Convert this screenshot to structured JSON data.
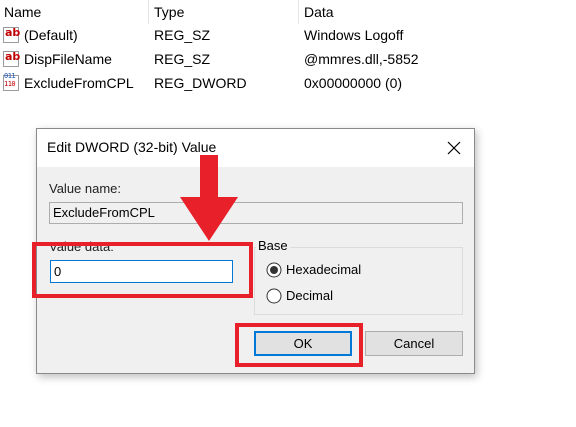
{
  "registry": {
    "headers": {
      "name": "Name",
      "type": "Type",
      "data": "Data"
    },
    "rows": [
      {
        "icon": "string-value-icon",
        "name": "(Default)",
        "type": "REG_SZ",
        "data": "Windows Logoff"
      },
      {
        "icon": "string-value-icon",
        "name": "DispFileName",
        "type": "REG_SZ",
        "data": "@mmres.dll,-5852"
      },
      {
        "icon": "dword-value-icon",
        "name": "ExcludeFromCPL",
        "type": "REG_DWORD",
        "data": "0x00000000 (0)"
      }
    ],
    "icon_glyphs": {
      "string": "ab",
      "binary_top": "011",
      "binary_bottom": "110"
    }
  },
  "dialog": {
    "title": "Edit DWORD (32-bit) Value",
    "value_name_label": "Value name:",
    "value_name": "ExcludeFromCPL",
    "value_data_label": "Value data:",
    "value_data": "0",
    "base_label": "Base",
    "base_options": [
      {
        "label": "Hexadecimal",
        "selected": true
      },
      {
        "label": "Decimal",
        "selected": false
      }
    ],
    "ok_label": "OK",
    "cancel_label": "Cancel"
  },
  "annotation": {
    "color": "#e8202a"
  }
}
